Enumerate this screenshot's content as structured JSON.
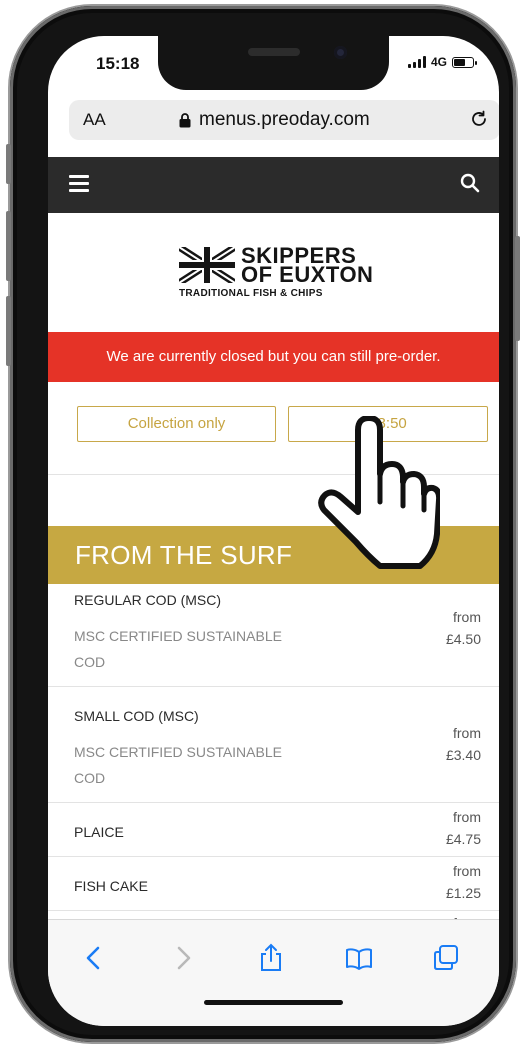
{
  "status": {
    "time": "15:18",
    "network": "4G",
    "battery_level": 0.55
  },
  "browser": {
    "text_size_label": "AA",
    "url": "menus.preoday.com"
  },
  "site": {
    "logo": {
      "line1": "SKIPPERS",
      "line2": "OF EUXTON",
      "tagline": "TRADITIONAL FISH & CHIPS"
    },
    "closed_message": "We are currently closed but you can still pre-order.",
    "order_mode": "Collection only",
    "order_time": "18:50",
    "section_title": "FROM THE SURF",
    "items": [
      {
        "name": "REGULAR COD (MSC)",
        "desc": "MSC CERTIFIED SUSTAINABLE COD",
        "from": "from",
        "price": "£4.50"
      },
      {
        "name": "SMALL COD (MSC)",
        "desc": "MSC CERTIFIED SUSTAINABLE COD",
        "from": "from",
        "price": "£3.40"
      },
      {
        "name": "PLAICE",
        "desc": "",
        "from": "from",
        "price": "£4.75"
      },
      {
        "name": "FISH CAKE",
        "desc": "",
        "from": "from",
        "price": "£1.25"
      },
      {
        "name": "",
        "desc": "",
        "from": "from",
        "price": ""
      }
    ]
  },
  "colors": {
    "brand_gold": "#c6a842",
    "alert_red": "#e53327",
    "nav_dark": "#2b2b2b",
    "ios_blue": "#1a7cf5"
  },
  "icons": [
    "menu-icon",
    "search-icon",
    "lock-icon",
    "reload-icon",
    "back-icon",
    "forward-icon",
    "share-icon",
    "bookmarks-icon",
    "tabs-icon",
    "hand-cursor-icon"
  ]
}
